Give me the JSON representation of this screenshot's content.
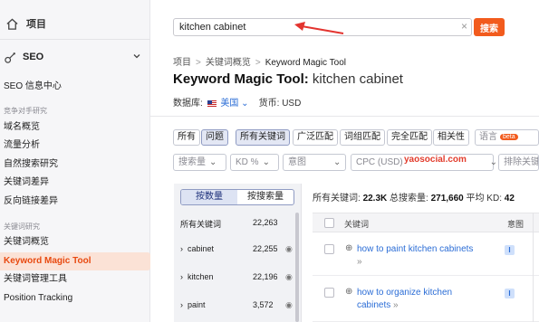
{
  "sidebar": {
    "home_label": "项目",
    "seo_label": "SEO",
    "items": [
      {
        "label": "SEO 信息中心"
      },
      {
        "section": "竞争对手研究"
      },
      {
        "label": "域名概览"
      },
      {
        "label": "流量分析"
      },
      {
        "label": "自然搜索研究"
      },
      {
        "label": "关键词差异"
      },
      {
        "label": "反向链接差异"
      },
      {
        "section": "关键词研究"
      },
      {
        "label": "关键词概览"
      },
      {
        "label": "Keyword Magic Tool",
        "active": true
      },
      {
        "label": "关键词管理工具"
      },
      {
        "label": "Position Tracking"
      }
    ]
  },
  "search": {
    "value": "kitchen cabinet",
    "clear": "×",
    "button": "搜索"
  },
  "breadcrumb": [
    "项目",
    "关键词概览",
    "Keyword Magic Tool"
  ],
  "title": {
    "tool": "Keyword Magic Tool:",
    "query": "kitchen cabinet"
  },
  "meta": {
    "db_label": "数据库:",
    "country": "美国",
    "currency_label": "货币:",
    "currency": "USD"
  },
  "filters": {
    "tabs1": [
      "所有",
      "问题"
    ],
    "tabs2": [
      "所有关键词",
      "广泛匹配",
      "词组匹配",
      "完全匹配",
      "相关性"
    ],
    "language": "语言",
    "beta": "beta",
    "dropdowns": [
      "搜索量",
      "KD %",
      "意图",
      "CPC (USD)",
      "排除关键"
    ]
  },
  "watermark": "yaosocial.com",
  "groups": {
    "tabs": [
      "按数量",
      "按搜索量"
    ],
    "header": {
      "label": "所有关键词",
      "count": "22,263"
    },
    "rows": [
      {
        "label": "cabinet",
        "count": "22,255"
      },
      {
        "label": "kitchen",
        "count": "22,196"
      },
      {
        "label": "paint",
        "count": "3,572"
      }
    ]
  },
  "stats": {
    "all_label": "所有关键词:",
    "all_value": "22.3K",
    "volume_label": "总搜索量:",
    "volume_value": "271,660",
    "kd_label": "平均 KD:",
    "kd_value": "42"
  },
  "table": {
    "col_keyword": "关键词",
    "col_intent": "意图",
    "rows": [
      {
        "keyword": "how to paint kitchen cabinets",
        "more": "»",
        "intent": "I"
      },
      {
        "keyword_line1": "how to organize kitchen",
        "keyword_line2": "cabinets",
        "more": "»",
        "intent": "I"
      }
    ]
  },
  "colors": {
    "accent": "#f25b1d",
    "link": "#2b6dd6",
    "active_bg": "#fbe2d6"
  }
}
